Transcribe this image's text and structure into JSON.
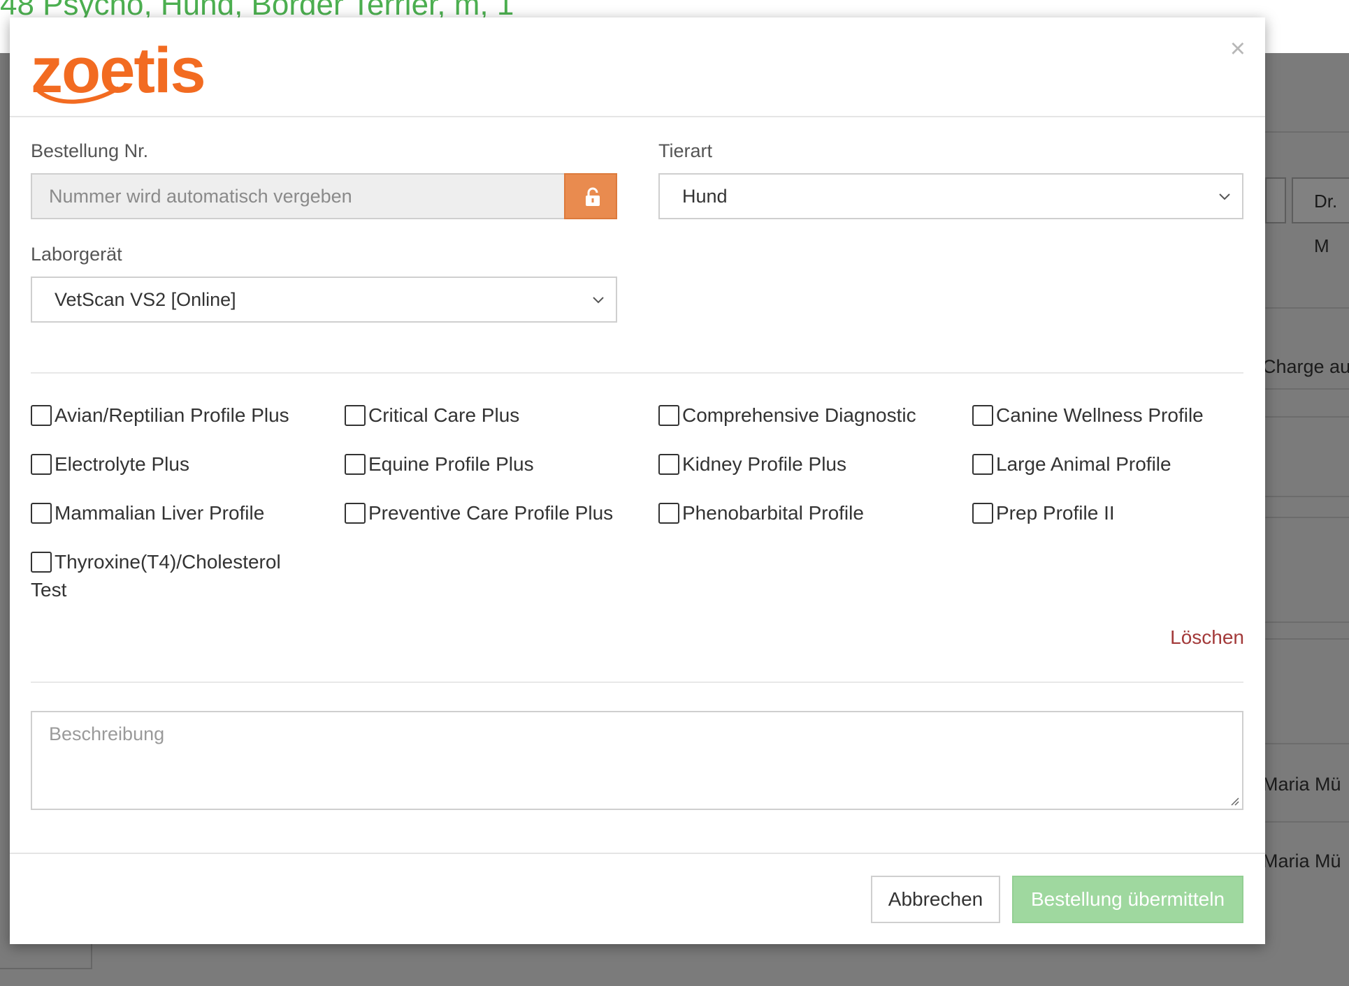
{
  "background": {
    "title": "48 Psycho, Hund, Border Terrier, m, 1",
    "doctor_button": "Dr. M",
    "charge_button": "Charge au",
    "rows": [
      "Maria Mü",
      "Maria Mü"
    ]
  },
  "modal": {
    "logo_text": "zoetis",
    "close_label": "×",
    "order_number": {
      "label": "Bestellung Nr.",
      "placeholder": "Nummer wird automatisch vergeben",
      "lock_icon": "unlock-icon"
    },
    "species": {
      "label": "Tierart",
      "value": "Hund"
    },
    "device": {
      "label": "Laborgerät",
      "value": "VetScan VS2 [Online]"
    },
    "profiles": [
      {
        "label": "Avian/Reptilian Profile Plus",
        "checked": false
      },
      {
        "label": "Critical Care Plus",
        "checked": false
      },
      {
        "label": "Comprehensive Diagnostic",
        "checked": false
      },
      {
        "label": "Canine Wellness Profile",
        "checked": false
      },
      {
        "label": "Electrolyte Plus",
        "checked": false
      },
      {
        "label": "Equine Profile Plus",
        "checked": false
      },
      {
        "label": "Kidney Profile Plus",
        "checked": false
      },
      {
        "label": "Large Animal Profile",
        "checked": false
      },
      {
        "label": "Mammalian Liver Profile",
        "checked": false
      },
      {
        "label": "Preventive Care Profile Plus",
        "checked": false
      },
      {
        "label": "Phenobarbital Profile",
        "checked": false
      },
      {
        "label": "Prep Profile II",
        "checked": false
      },
      {
        "label": "Thyroxine(T4)/Cholesterol Test",
        "checked": false
      }
    ],
    "delete_label": "Löschen",
    "description_placeholder": "Beschreibung",
    "cancel_label": "Abbrechen",
    "submit_label": "Bestellung übermitteln"
  },
  "colors": {
    "brand": "#f26b21",
    "lock_button": "#e98b4f",
    "submit_disabled": "#9fd89f",
    "delete_link": "#a33a3a"
  }
}
